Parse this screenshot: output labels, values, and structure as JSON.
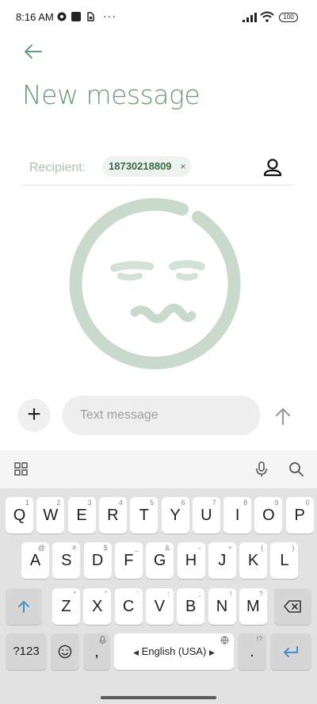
{
  "status_bar": {
    "time": "8:16 AM",
    "dots": "···",
    "battery": "100"
  },
  "header": {
    "title": "New message",
    "back_icon": "arrow-left-icon"
  },
  "recipient": {
    "label": "Recipient:",
    "chip": "18730218809",
    "chip_close": "×",
    "contact_icon": "person-icon"
  },
  "compose": {
    "placeholder": "Text message",
    "attach_label": "+",
    "send_icon": "arrow-up-icon"
  },
  "keyboard": {
    "toolbar": [
      "apps-grid-icon",
      "microphone-icon",
      "search-icon"
    ],
    "row1": [
      {
        "k": "Q",
        "h": "1"
      },
      {
        "k": "W",
        "h": "2"
      },
      {
        "k": "E",
        "h": "3"
      },
      {
        "k": "R",
        "h": "4"
      },
      {
        "k": "T",
        "h": "5"
      },
      {
        "k": "Y",
        "h": "6"
      },
      {
        "k": "U",
        "h": "7"
      },
      {
        "k": "I",
        "h": "8"
      },
      {
        "k": "O",
        "h": "9"
      },
      {
        "k": "P",
        "h": "0"
      }
    ],
    "row2": [
      {
        "k": "A",
        "h": "@"
      },
      {
        "k": "S",
        "h": "#"
      },
      {
        "k": "D",
        "h": "$"
      },
      {
        "k": "F",
        "h": "_"
      },
      {
        "k": "G",
        "h": "&"
      },
      {
        "k": "H",
        "h": "-"
      },
      {
        "k": "J",
        "h": "+"
      },
      {
        "k": "K",
        "h": "("
      },
      {
        "k": "L",
        "h": ")"
      }
    ],
    "row3": [
      {
        "k": "Z",
        "h": "*"
      },
      {
        "k": "X",
        "h": "\""
      },
      {
        "k": "C",
        "h": "'"
      },
      {
        "k": "V",
        "h": ":"
      },
      {
        "k": "B",
        "h": ";"
      },
      {
        "k": "N",
        "h": "!"
      },
      {
        "k": "M",
        "h": "?"
      }
    ],
    "symbols_key": "?123",
    "comma": ",",
    "space_label": "English (USA)",
    "space_left": "◀",
    "space_right": "▶",
    "period": ".",
    "period_hint": "!?",
    "colors": {
      "accent": "#4a90c8",
      "title_green": "#6b9a76",
      "illustration": "#c9d9cc"
    }
  }
}
